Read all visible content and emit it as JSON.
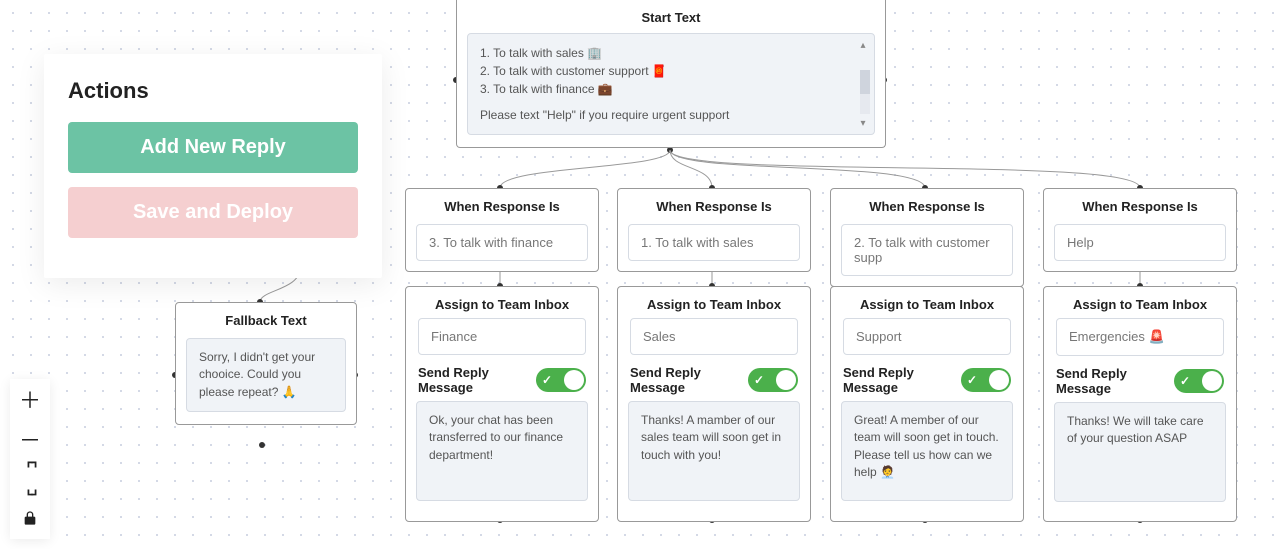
{
  "actions": {
    "title": "Actions",
    "add_label": "Add New Reply",
    "save_label": "Save and Deploy"
  },
  "zoom": {
    "plus": "＋",
    "minus": "－",
    "fullscreen": "⛶",
    "lock": "🔒"
  },
  "start": {
    "title": "Start Text",
    "line1": "1. To talk with sales 🏢",
    "line2": "2. To talk with customer support 🧧",
    "line3": "3. To talk with finance 💼",
    "help": "Please text \"Help\" if you require urgent support"
  },
  "fallback": {
    "title": "Fallback Text",
    "body": "Sorry, I didn't get your chooice. Could you please repeat? 🙏"
  },
  "branches": [
    {
      "when_title": "When Response Is",
      "when_value": "3. To talk with finance",
      "assign_title": "Assign to Team Inbox",
      "assign_value": "Finance",
      "send_label": "Send Reply Message",
      "reply": "Ok, your chat has been transferred to our finance department!"
    },
    {
      "when_title": "When Response Is",
      "when_value": "1. To talk with sales",
      "assign_title": "Assign to Team Inbox",
      "assign_value": "Sales",
      "send_label": "Send Reply Message",
      "reply": "Thanks! A mamber of our sales team will soon get in touch with you!"
    },
    {
      "when_title": "When Response Is",
      "when_value": "2. To talk with customer supp",
      "assign_title": "Assign to Team Inbox",
      "assign_value": "Support",
      "send_label": "Send Reply Message",
      "reply": "Great! A member of our team will soon get in touch. Please tell us how can we help 🧑‍💼"
    },
    {
      "when_title": "When Response Is",
      "when_value": "Help",
      "assign_title": "Assign to Team Inbox",
      "assign_value": "Emergencies 🚨",
      "send_label": "Send Reply Message",
      "reply": "Thanks! We will take care of your question ASAP"
    }
  ]
}
